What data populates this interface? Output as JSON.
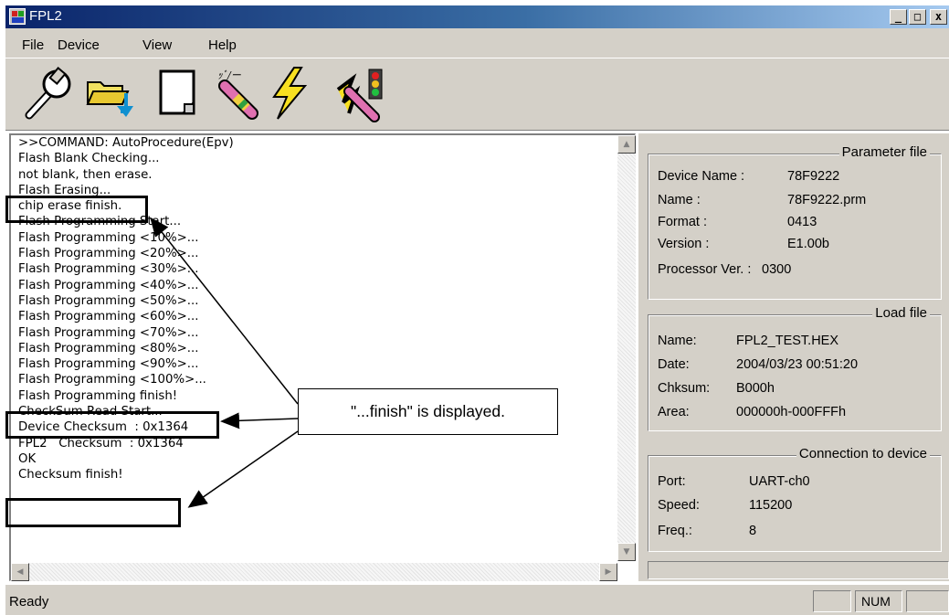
{
  "window": {
    "title": "FPL2",
    "min_label": "_",
    "max_label": "□",
    "close_label": "x"
  },
  "menu": [
    {
      "label": "File"
    },
    {
      "label": "Device"
    },
    {
      "label": "View"
    },
    {
      "label": "Help"
    }
  ],
  "toolbar": {
    "tools": [
      {
        "icon": "wrench-icon"
      },
      {
        "icon": "open-folder-icon"
      },
      {
        "icon": "blank-page-icon"
      },
      {
        "icon": "verify-eraser-icon"
      },
      {
        "icon": "lightning-program-icon"
      },
      {
        "icon": "autoprocedure-icon"
      }
    ]
  },
  "log": {
    "lines": [
      ">>COMMAND: AutoProcedure(Epv)",
      "Flash Blank Checking...",
      "not blank, then erase.",
      "Flash Erasing...",
      "chip erase finish.",
      "Flash Programming Start...",
      "Flash Programming <10%>...",
      "Flash Programming <20%>...",
      "Flash Programming <30%>...",
      "Flash Programming <40%>...",
      "Flash Programming <50%>...",
      "Flash Programming <60%>...",
      "Flash Programming <70%>...",
      "Flash Programming <80%>...",
      "Flash Programming <90%>...",
      "Flash Programming <100%>...",
      "Flash Programming finish!",
      "CheckSum Read Start...",
      "Device Checksum  : 0x1364",
      "FPL2   Checksum  : 0x1364",
      "OK",
      "Checksum finish!"
    ]
  },
  "annotation": {
    "callout_text": "\"...finish\" is displayed."
  },
  "parameter_file": {
    "title": "Parameter file",
    "rows": [
      {
        "label": "Device Name :",
        "value": "78F9222"
      },
      {
        "label": "Name :",
        "value": "78F9222.prm"
      },
      {
        "label": "Format :",
        "value": "0413"
      },
      {
        "label": "Version :",
        "value": "E1.00b"
      },
      {
        "label": "Processor Ver. :",
        "value": "0300"
      }
    ]
  },
  "load_file": {
    "title": "Load file",
    "rows": [
      {
        "label": "Name:",
        "value": "FPL2_TEST.HEX"
      },
      {
        "label": "Date:",
        "value": "2004/03/23 00:51:20"
      },
      {
        "label": "Chksum:",
        "value": "B000h"
      },
      {
        "label": "Area:",
        "value": "000000h-000FFFh"
      }
    ]
  },
  "connection": {
    "title": "Connection to device",
    "rows": [
      {
        "label": "Port:",
        "value": "UART-ch0"
      },
      {
        "label": "Speed:",
        "value": "115200"
      },
      {
        "label": "Freq.:",
        "value": "8"
      }
    ]
  },
  "status": {
    "text": "Ready",
    "num": "NUM"
  },
  "colors": {
    "title_start": "#0a246a",
    "title_end": "#a6caf0",
    "face": "#d4d0c8"
  }
}
